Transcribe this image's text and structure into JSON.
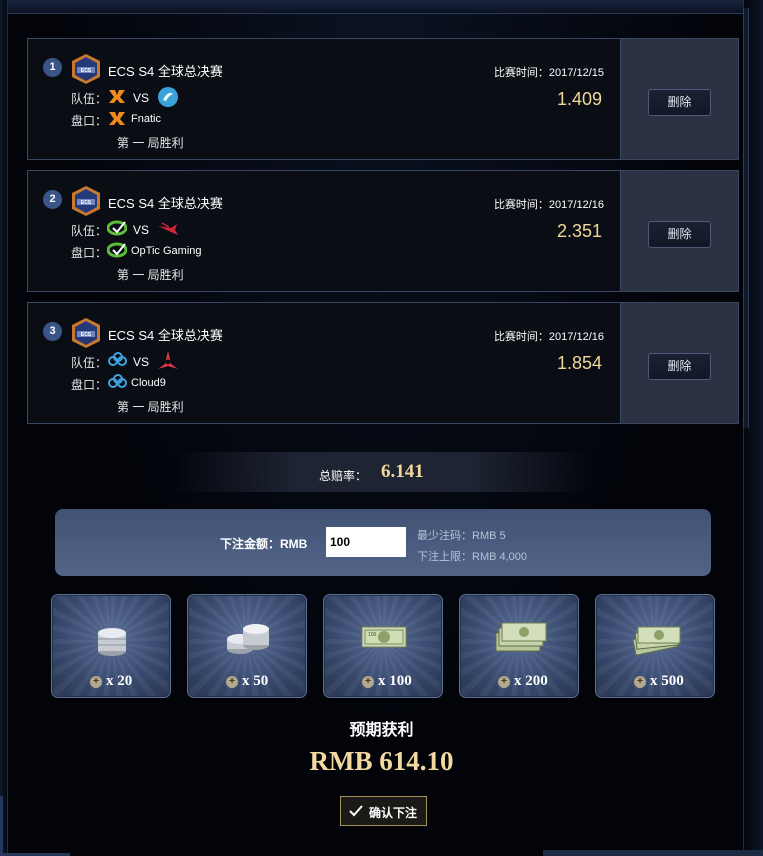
{
  "bets": [
    {
      "index": "1",
      "event": "ECS S4 全球总决赛",
      "team_label": "队伍：",
      "vs": "VS",
      "team_a_icon": "fnatic-logo-icon",
      "team_b_icon": "luminosity-logo-icon",
      "line_label": "盘口：",
      "line_icon": "fnatic-logo-icon",
      "line_team": "Fnatic",
      "market": "第 一 局胜利",
      "date": "比赛时间：2017/12/15",
      "odds": "1.409",
      "delete_label": "删除"
    },
    {
      "index": "2",
      "event": "ECS S4 全球总决赛",
      "team_label": "队伍：",
      "vs": "VS",
      "team_a_icon": "optic-gaming-logo-icon",
      "team_b_icon": "mousesports-logo-icon",
      "line_label": "盘口：",
      "line_icon": "optic-gaming-logo-icon",
      "line_team": "OpTic Gaming",
      "market": "第 一 局胜利",
      "date": "比赛时间：2017/12/16",
      "odds": "2.351",
      "delete_label": "删除"
    },
    {
      "index": "3",
      "event": "ECS S4 全球总决赛",
      "team_label": "队伍：",
      "vs": "VS",
      "team_a_icon": "cloud9-logo-icon",
      "team_b_icon": "astralis-logo-icon",
      "line_label": "盘口：",
      "line_icon": "cloud9-logo-icon",
      "line_team": "Cloud9",
      "market": "第 一 局胜利",
      "date": "比赛时间：2017/12/16",
      "odds": "1.854",
      "delete_label": "删除"
    }
  ],
  "total": {
    "label": "总赔率：",
    "value": "6.141"
  },
  "bet_amount": {
    "label": "下注金额：RMB",
    "value": "100",
    "min_text": "最少注码：RMB 5",
    "max_text": "下注上限：RMB 4,000"
  },
  "chips": [
    {
      "label": "x 20",
      "icon": "silver-coin-stack-icon"
    },
    {
      "label": "x 50",
      "icon": "silver-coin-pile-icon"
    },
    {
      "label": "x 100",
      "icon": "banknote-icon"
    },
    {
      "label": "x 200",
      "icon": "banknote-stack-icon"
    },
    {
      "label": "x 500",
      "icon": "banknote-fan-icon"
    }
  ],
  "expected": {
    "label": "预期获利",
    "value": "RMB 614.10"
  },
  "confirm_label": "确认下注",
  "colors": {
    "odds_gold": "#f2d79a",
    "badge_blue": "#3b5488",
    "panel_blue": "#4a5c80",
    "card_bg": "#0a0d14",
    "side_bg": "#2a3244"
  }
}
